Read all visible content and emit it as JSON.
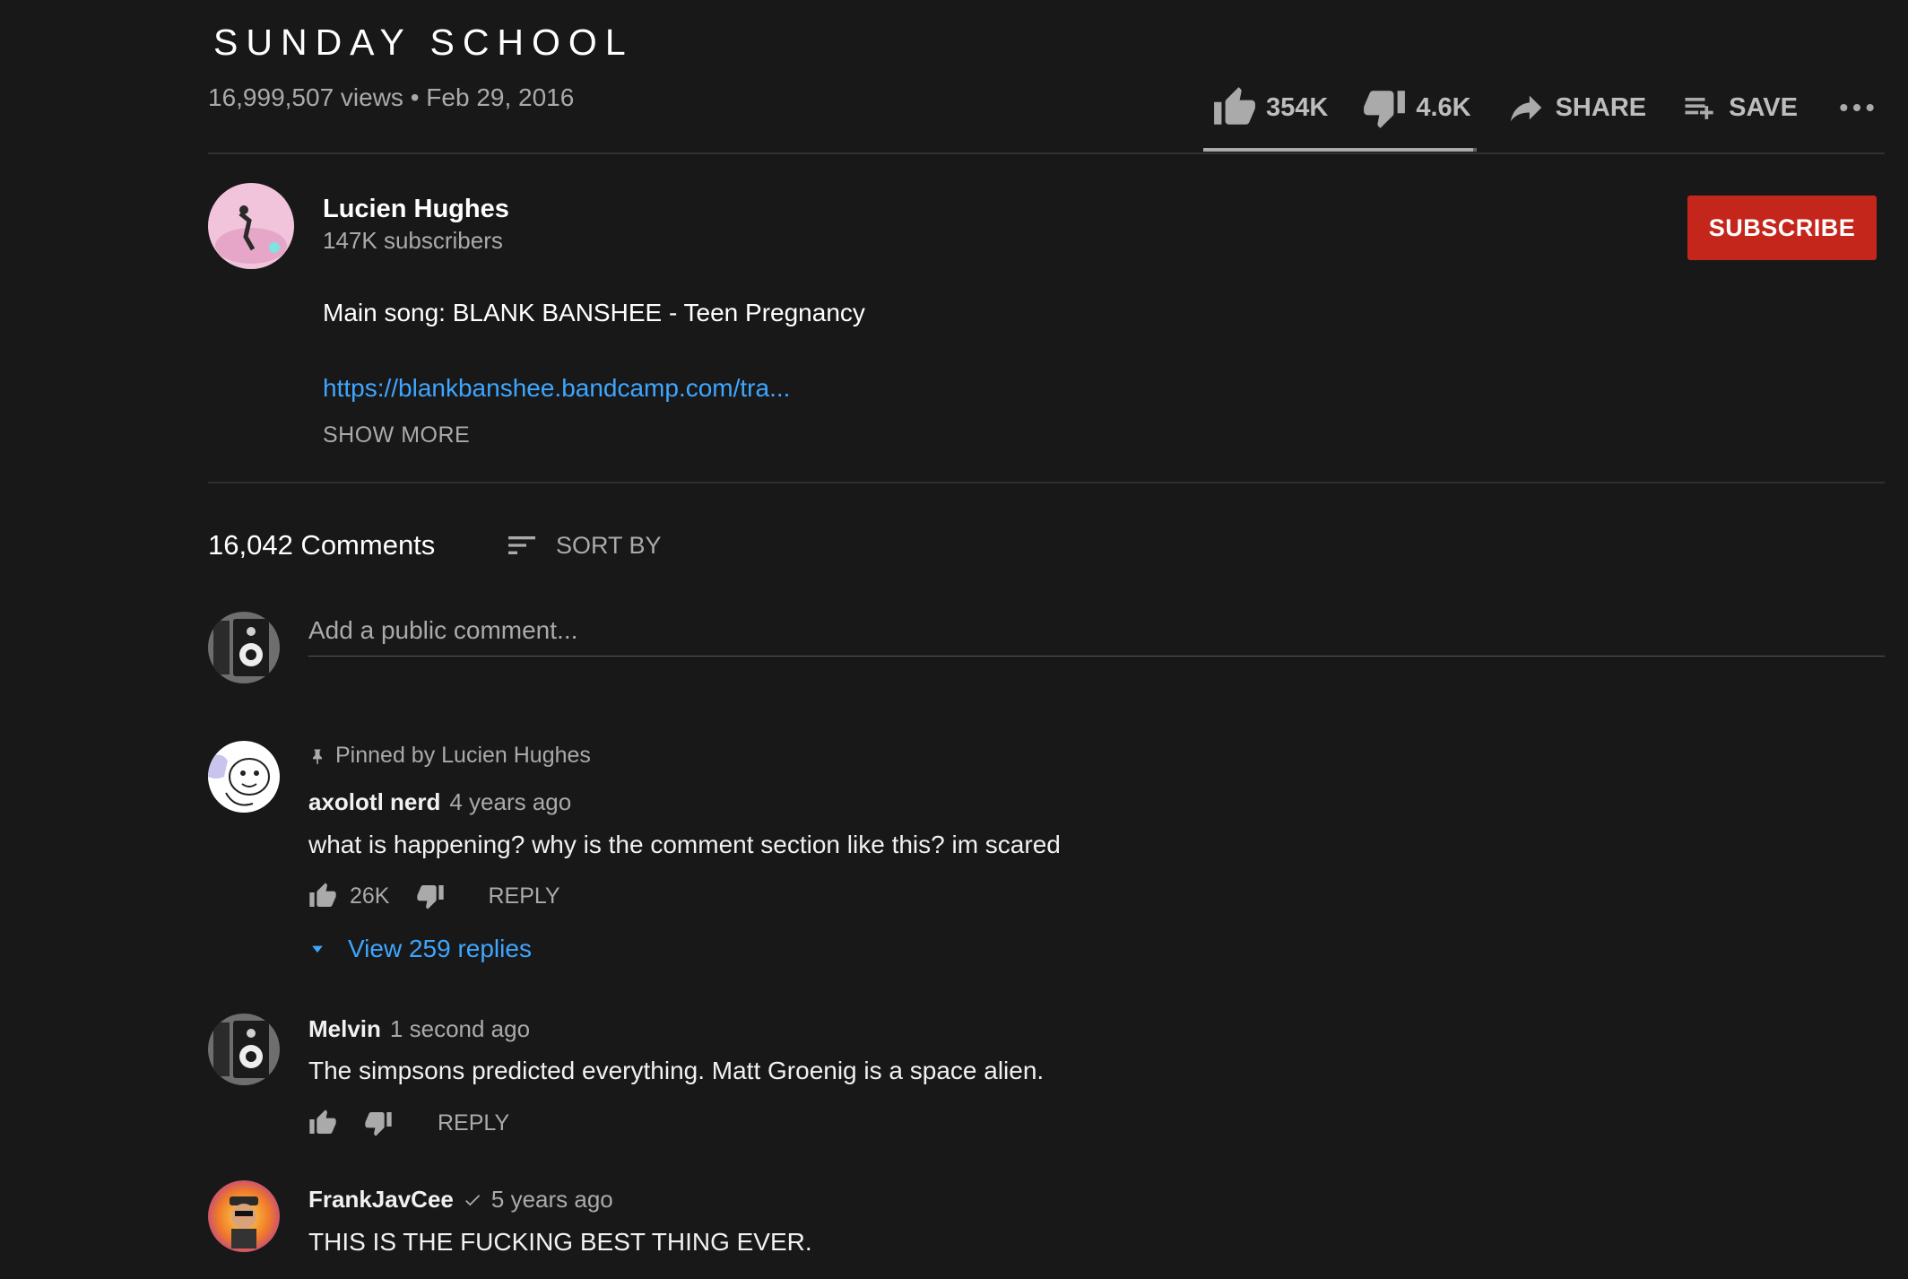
{
  "video": {
    "title": "SUNDAY SCHOOL",
    "meta": "16,999,507 views • Feb 29, 2016",
    "likes": "354K",
    "dislikes": "4.6K",
    "share_label": "SHARE",
    "save_label": "SAVE",
    "like_ratio": 0.987
  },
  "channel": {
    "name": "Lucien Hughes",
    "subscribers": "147K subscribers",
    "subscribe_label": "SUBSCRIBE"
  },
  "description": {
    "line1": "Main song: BLANK BANSHEE - Teen Pregnancy",
    "link": "https://blankbanshee.bandcamp.com/tra...",
    "show_more": "SHOW MORE"
  },
  "comments_header": {
    "count": "16,042 Comments",
    "sort_label": "SORT BY",
    "add_placeholder": "Add a public comment..."
  },
  "comments": [
    {
      "pinned": "Pinned by Lucien Hughes",
      "author": "axolotl nerd",
      "time": "4 years ago",
      "text": "what is happening? why is the comment section like this? im scared",
      "likes": "26K",
      "reply_label": "REPLY",
      "view_replies": "View 259 replies"
    },
    {
      "author": "Melvin",
      "time": "1 second ago",
      "text": "The simpsons predicted everything. Matt Groenig is a space alien.",
      "reply_label": "REPLY"
    },
    {
      "author": "FrankJavCee",
      "verified_icon": "check-icon",
      "time": "5 years ago",
      "text": "THIS IS THE FUCKING BEST THING EVER."
    }
  ],
  "colors": {
    "background": "#181818",
    "accent_red": "#c4261c",
    "link_blue": "#3ea6ff",
    "secondary_text": "#aaaaaa"
  }
}
